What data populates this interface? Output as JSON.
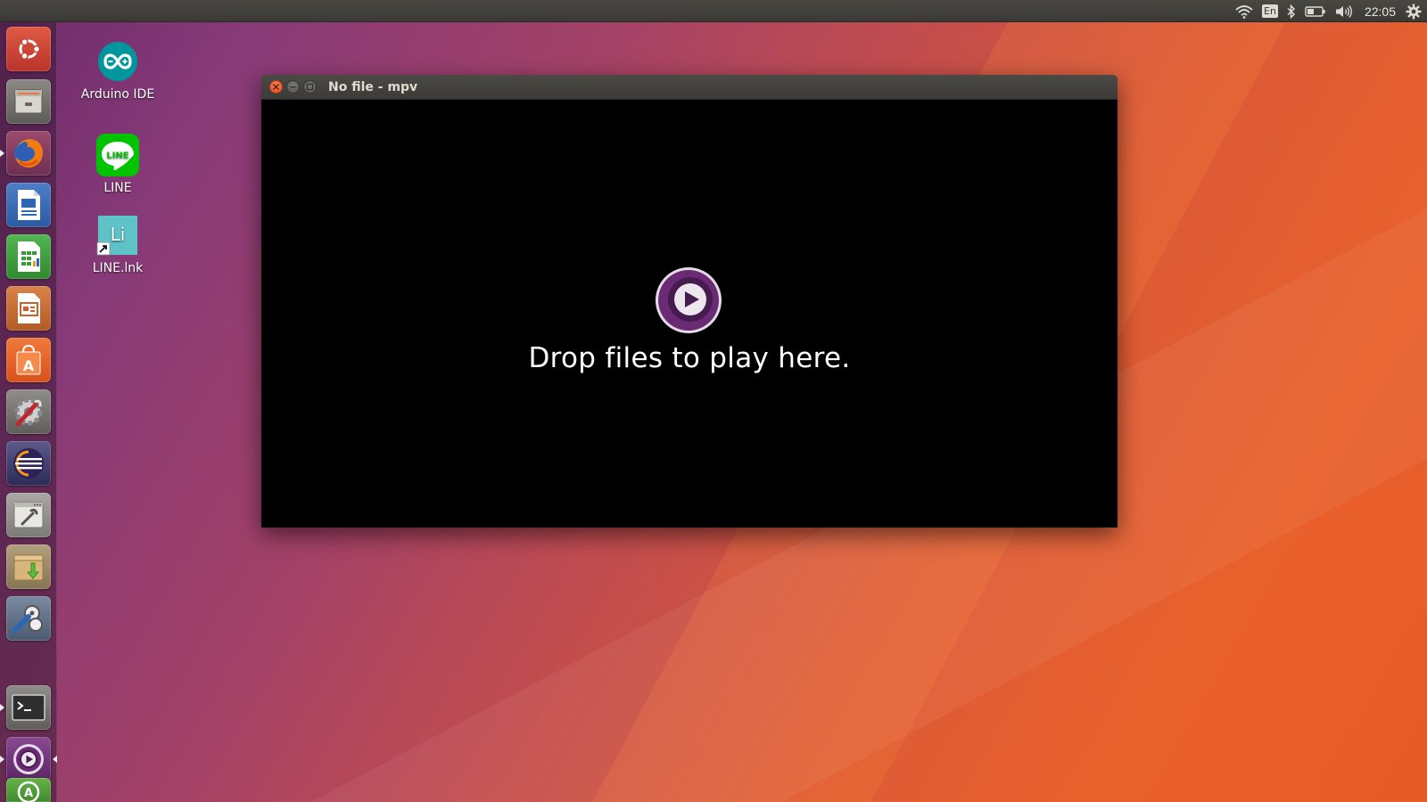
{
  "top_panel": {
    "indicators": [
      "wifi-icon",
      "keyboard-layout",
      "bluetooth-icon",
      "battery-icon",
      "volume-icon",
      "clock",
      "system-gear-icon"
    ],
    "keyboard_layout": "En",
    "clock": "22:05"
  },
  "launcher": {
    "items": [
      {
        "name": "ubuntu-dash-icon",
        "color": "#d24a3a"
      },
      {
        "name": "files-icon",
        "color": "#6b6a66"
      },
      {
        "name": "firefox-icon",
        "color": "#e66000",
        "running": true
      },
      {
        "name": "libreoffice-writer-icon",
        "color": "#2a68b6"
      },
      {
        "name": "libreoffice-calc-icon",
        "color": "#3a9a3a"
      },
      {
        "name": "libreoffice-impress-icon",
        "color": "#c8622a"
      },
      {
        "name": "ubuntu-software-icon",
        "color": "#e85b25"
      },
      {
        "name": "system-settings-icon",
        "color": "#7a7a7a"
      },
      {
        "name": "eclipse-icon",
        "color": "#2c2255"
      },
      {
        "name": "system-tools-icon",
        "color": "#8a8a8a"
      },
      {
        "name": "archive-manager-icon",
        "color": "#c9a060"
      },
      {
        "name": "video-editor-icon",
        "color": "#5a6a80"
      },
      {
        "name": "terminal-icon",
        "color": "#333333",
        "running": true
      },
      {
        "name": "mpv-icon",
        "color": "#6b2b74",
        "running": true,
        "focused": true
      },
      {
        "name": "software-updater-icon",
        "color": "#4e9a3e"
      }
    ]
  },
  "desktop": {
    "icons": [
      {
        "label": "Arduino IDE",
        "icon": "arduino-icon",
        "color": "#00979c"
      },
      {
        "label": "LINE",
        "icon": "line-icon",
        "color": "#00c300"
      },
      {
        "label": "LINE.lnk",
        "icon": "line-shortcut-icon",
        "color": "#5ec3c8",
        "glyph": "Li"
      }
    ]
  },
  "window": {
    "title": "No file - mpv",
    "message": "Drop files to play here.",
    "accent": "#6b2b74"
  }
}
